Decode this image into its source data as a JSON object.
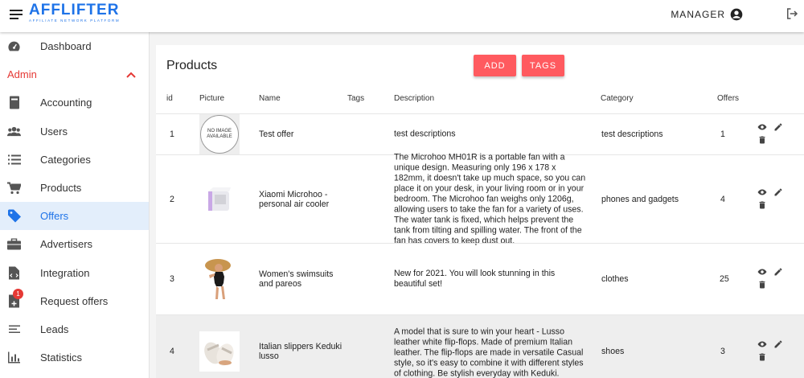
{
  "header": {
    "logo": "AFFLIFTER",
    "logo_tagline": "AFFILIATE NETWORK PLATFORM",
    "user_label": "MANAGER"
  },
  "sidebar": {
    "items": [
      {
        "label": "Dashboard",
        "icon": "speedometer-icon"
      },
      {
        "label": "Admin",
        "icon": "chevron-up-icon"
      },
      {
        "label": "Accounting",
        "icon": "book-icon"
      },
      {
        "label": "Users",
        "icon": "users-icon"
      },
      {
        "label": "Categories",
        "icon": "list-icon"
      },
      {
        "label": "Products",
        "icon": "cart-icon"
      },
      {
        "label": "Offers",
        "icon": "tag-icon"
      },
      {
        "label": "Advertisers",
        "icon": "briefcase-icon"
      },
      {
        "label": "Integration",
        "icon": "file-code-icon"
      },
      {
        "label": "Request offers",
        "icon": "file-plus-icon",
        "badge": "1"
      },
      {
        "label": "Leads",
        "icon": "leads-list-icon"
      },
      {
        "label": "Statistics",
        "icon": "bar-chart-icon"
      }
    ]
  },
  "page": {
    "title": "Products",
    "add_label": "ADD",
    "tags_label": "TAGS"
  },
  "table": {
    "columns": [
      "id",
      "Picture",
      "Name",
      "Tags",
      "Description",
      "Category",
      "Offers"
    ],
    "no_image_text": "NO IMAGE AVAILABLE",
    "rows": [
      {
        "id": "1",
        "name": "Test offer",
        "description": "test descriptions",
        "category": "test descriptions",
        "offers": "1",
        "picture": "no-image"
      },
      {
        "id": "2",
        "name": "Xiaomi Microhoo - personal air cooler",
        "description": "The Microhoo MH01R is a portable fan with a unique design. Measuring only 196 x 178 x 182mm, it doesn't take up much space, so you can place it on your desk, in your living room or in your bedroom. The Microhoo fan weighs only 1206g, allowing users to take the fan for a variety of uses. The water tank is fixed, which helps prevent the tank from tilting and spilling water. The front of the fan has covers to keep dust out.",
        "category": "phones and gadgets",
        "offers": "4",
        "picture": "air-cooler"
      },
      {
        "id": "3",
        "name": "Women's swimsuits and pareos",
        "description": "New for 2021. You will look stunning in this beautiful set!",
        "category": "clothes",
        "offers": "25",
        "picture": "swimsuit"
      },
      {
        "id": "4",
        "name": "Italian slippers Keduki lusso",
        "description": "A model that is sure to win your heart - Lusso leather white flip-flops. Made of premium Italian leather. The flip-flops are made in versatile Casual style, so it's easy to combine it with different styles of clothing. Be stylish everyday with Keduki.",
        "category": "shoes",
        "offers": "3",
        "picture": "slippers"
      }
    ]
  },
  "colors": {
    "brand": "#1e73e8",
    "accent": "#ff5a5f",
    "admin": "#e53935"
  }
}
